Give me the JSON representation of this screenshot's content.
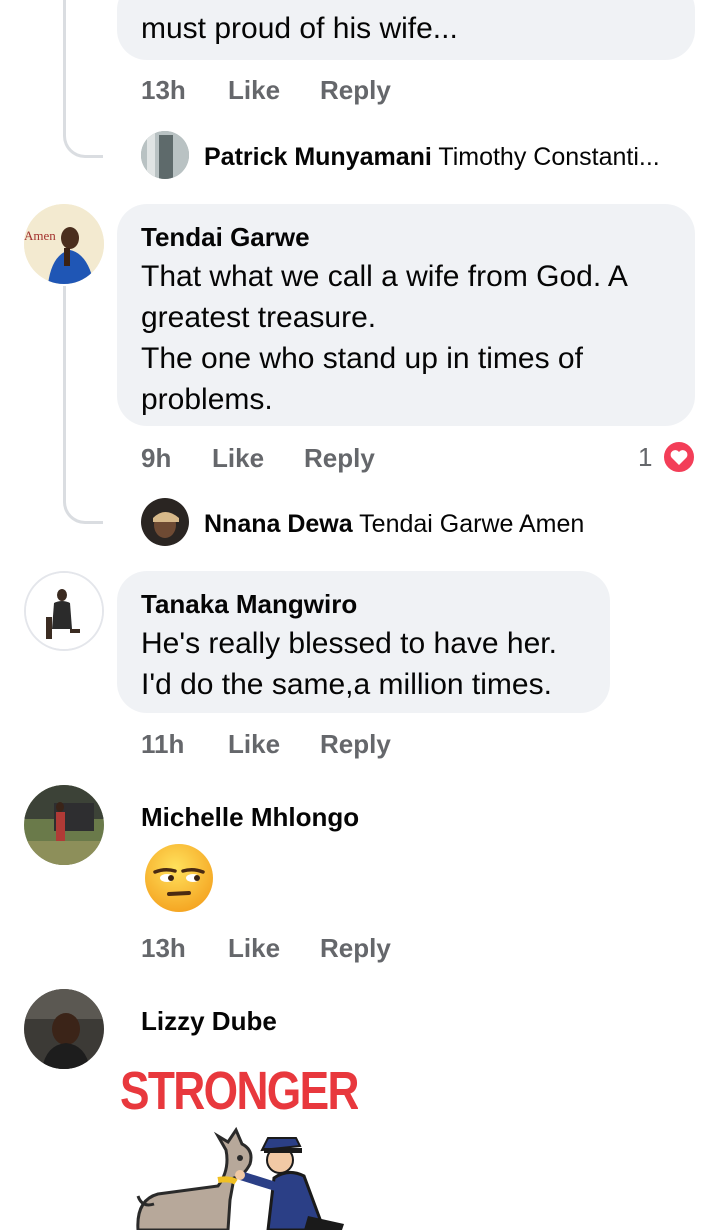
{
  "comments": [
    {
      "text_lines": [
        "must proud of his wife..."
      ],
      "time": "13h",
      "like": "Like",
      "reply": "Reply",
      "reply_preview": {
        "name": "Patrick Munyamani",
        "text": "Timothy Constanti..."
      }
    },
    {
      "name": "Tendai Garwe",
      "avatar_overlay_text": "Amen",
      "text_lines": [
        "That what we call a wife from God. A",
        "greatest treasure.",
        "The one who stand up in times of",
        "problems."
      ],
      "time": "9h",
      "like": "Like",
      "reply": "Reply",
      "reaction_count": "1",
      "reply_preview": {
        "name": "Nnana Dewa",
        "text": "Tendai Garwe Amen"
      }
    },
    {
      "name": "Tanaka Mangwiro",
      "text_lines": [
        "He's really blessed to have her.",
        "I'd do the same,a million times."
      ],
      "time": "11h",
      "like": "Like",
      "reply": "Reply"
    },
    {
      "name": "Michelle Mhlongo",
      "emoji": "unamused-face",
      "time": "13h",
      "like": "Like",
      "reply": "Reply"
    },
    {
      "name": "Lizzy Dube",
      "sticker_text": "STRONGER"
    }
  ],
  "colors": {
    "bubble": "#f0f2f5",
    "meta_text": "#65676b",
    "reaction_red": "#f33e58",
    "sticker_red": "#e8383d"
  }
}
